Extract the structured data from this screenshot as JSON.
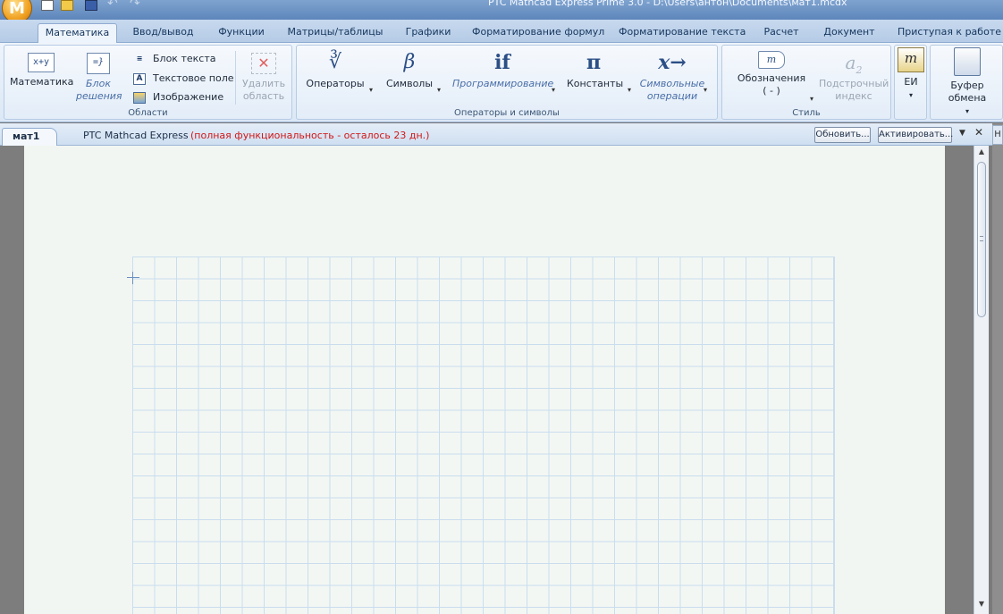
{
  "window": {
    "title": "PTC Mathcad Express Prime 3.0 - D:\\Users\\антон\\Documents\\мат1.mcdx",
    "app_logo": "M"
  },
  "quick_access": [
    "new-icon",
    "open-icon",
    "save-icon",
    "undo-icon",
    "redo-icon"
  ],
  "tabs": [
    {
      "label": "Математика",
      "active": true
    },
    {
      "label": "Ввод/вывод"
    },
    {
      "label": "Функции"
    },
    {
      "label": "Матрицы/таблицы"
    },
    {
      "label": "Графики"
    },
    {
      "label": "Форматирование формул"
    },
    {
      "label": "Форматирование текста"
    },
    {
      "label": "Расчет"
    },
    {
      "label": "Документ"
    },
    {
      "label": "Приступая к работе"
    }
  ],
  "ribbon": {
    "regions": {
      "label": "Области",
      "math_icon": "x+y",
      "math": "Математика",
      "solve_block_line1": "Блок",
      "solve_block_line2": "решения",
      "text_block": "Блок текста",
      "text_box_icon": "A",
      "text_box": "Текстовое поле",
      "image": "Изображение",
      "delete_line1": "Удалить",
      "delete_line2": "область"
    },
    "operators": {
      "label": "Операторы и символы",
      "operators": "Операторы",
      "operators_glyph": "∛",
      "symbols": "Символы",
      "symbols_glyph": "β",
      "programming": "Программирование",
      "programming_glyph": "if",
      "constants": "Константы",
      "constants_glyph": "π",
      "symbolic_line1": "Символьные",
      "symbolic_line2": "операции",
      "symbolic_glyph": "x→"
    },
    "style": {
      "label": "Стиль",
      "labels_line1": "Обозначения",
      "labels_line2": "( - )",
      "subscript_line1": "Подстрочный",
      "subscript_line2": "индекс",
      "subscript_glyph": "a",
      "subscript_sub": "2"
    },
    "units": {
      "label": "ЕИ",
      "glyph": "m"
    },
    "clipboard": {
      "label": "Буфер обмена"
    }
  },
  "document": {
    "tab": "мат1",
    "product": "PTC Mathcad Express",
    "trial_notice": "(полная функциональность - осталось 23 дн.)",
    "update_button": "Обновить...",
    "activate_button": "Активировать...",
    "side_tab": "Н"
  }
}
